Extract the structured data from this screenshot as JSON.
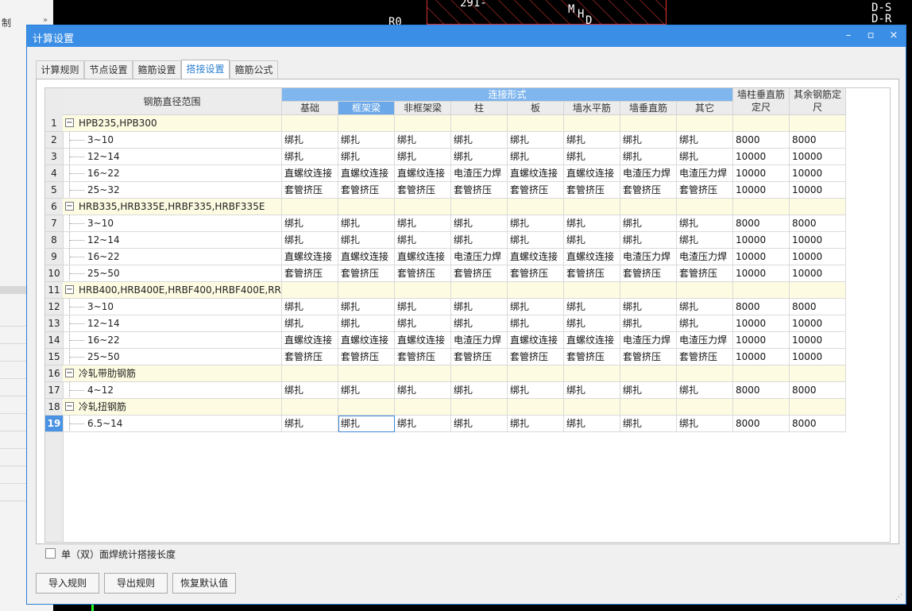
{
  "background": {
    "left_label": "制",
    "cad_texts": [
      "291-",
      "M",
      "H",
      "D",
      "D-S",
      "R0",
      "D-R"
    ]
  },
  "dialog": {
    "title": "计算设置",
    "tabs": [
      "计算规则",
      "节点设置",
      "箍筋设置",
      "搭接设置",
      "箍筋公式"
    ],
    "active_tab": "搭接设置"
  },
  "grid": {
    "name_header": "钢筋直径范围",
    "group_header": "连接形式",
    "columns": [
      "基础",
      "框架梁",
      "非框架梁",
      "柱",
      "板",
      "墙水平筋",
      "墙垂直筋",
      "其它"
    ],
    "extra_col1_line1": "墙柱垂直筋",
    "extra_col1_line2": "定尺",
    "extra_col2_line1": "其余钢筋定",
    "extra_col2_line2": "尺",
    "rows": [
      {
        "num": "1",
        "group": true,
        "name": "HPB235,HPB300"
      },
      {
        "num": "2",
        "name": "3~10",
        "vals": [
          "绑扎",
          "绑扎",
          "绑扎",
          "绑扎",
          "绑扎",
          "绑扎",
          "绑扎",
          "绑扎",
          "8000",
          "8000"
        ]
      },
      {
        "num": "3",
        "name": "12~14",
        "vals": [
          "绑扎",
          "绑扎",
          "绑扎",
          "绑扎",
          "绑扎",
          "绑扎",
          "绑扎",
          "绑扎",
          "10000",
          "10000"
        ]
      },
      {
        "num": "4",
        "name": "16~22",
        "vals": [
          "直螺纹连接",
          "直螺纹连接",
          "直螺纹连接",
          "电渣压力焊",
          "直螺纹连接",
          "直螺纹连接",
          "电渣压力焊",
          "电渣压力焊",
          "10000",
          "10000"
        ]
      },
      {
        "num": "5",
        "name": "25~32",
        "vals": [
          "套管挤压",
          "套管挤压",
          "套管挤压",
          "套管挤压",
          "套管挤压",
          "套管挤压",
          "套管挤压",
          "套管挤压",
          "10000",
          "10000"
        ]
      },
      {
        "num": "6",
        "group": true,
        "name": "HRB335,HRB335E,HRBF335,HRBF335E"
      },
      {
        "num": "7",
        "name": "3~10",
        "vals": [
          "绑扎",
          "绑扎",
          "绑扎",
          "绑扎",
          "绑扎",
          "绑扎",
          "绑扎",
          "绑扎",
          "8000",
          "8000"
        ]
      },
      {
        "num": "8",
        "name": "12~14",
        "vals": [
          "绑扎",
          "绑扎",
          "绑扎",
          "绑扎",
          "绑扎",
          "绑扎",
          "绑扎",
          "绑扎",
          "10000",
          "10000"
        ]
      },
      {
        "num": "9",
        "name": "16~22",
        "vals": [
          "直螺纹连接",
          "直螺纹连接",
          "直螺纹连接",
          "电渣压力焊",
          "直螺纹连接",
          "直螺纹连接",
          "电渣压力焊",
          "电渣压力焊",
          "10000",
          "10000"
        ]
      },
      {
        "num": "10",
        "name": "25~50",
        "vals": [
          "套管挤压",
          "套管挤压",
          "套管挤压",
          "套管挤压",
          "套管挤压",
          "套管挤压",
          "套管挤压",
          "套管挤压",
          "10000",
          "10000"
        ]
      },
      {
        "num": "11",
        "group": true,
        "name": "HRB400,HRB400E,HRBF400,HRBF400E,RR..."
      },
      {
        "num": "12",
        "name": "3~10",
        "vals": [
          "绑扎",
          "绑扎",
          "绑扎",
          "绑扎",
          "绑扎",
          "绑扎",
          "绑扎",
          "绑扎",
          "8000",
          "8000"
        ]
      },
      {
        "num": "13",
        "name": "12~14",
        "vals": [
          "绑扎",
          "绑扎",
          "绑扎",
          "绑扎",
          "绑扎",
          "绑扎",
          "绑扎",
          "绑扎",
          "10000",
          "10000"
        ]
      },
      {
        "num": "14",
        "name": "16~22",
        "vals": [
          "直螺纹连接",
          "直螺纹连接",
          "直螺纹连接",
          "电渣压力焊",
          "直螺纹连接",
          "直螺纹连接",
          "电渣压力焊",
          "电渣压力焊",
          "10000",
          "10000"
        ]
      },
      {
        "num": "15",
        "name": "25~50",
        "vals": [
          "套管挤压",
          "套管挤压",
          "套管挤压",
          "套管挤压",
          "套管挤压",
          "套管挤压",
          "套管挤压",
          "套管挤压",
          "10000",
          "10000"
        ]
      },
      {
        "num": "16",
        "group": true,
        "name": "冷轧带肋钢筋"
      },
      {
        "num": "17",
        "name": "4~12",
        "vals": [
          "绑扎",
          "绑扎",
          "绑扎",
          "绑扎",
          "绑扎",
          "绑扎",
          "绑扎",
          "绑扎",
          "8000",
          "8000"
        ]
      },
      {
        "num": "18",
        "group": true,
        "name": "冷轧扭钢筋"
      },
      {
        "num": "19",
        "name": "6.5~14",
        "active": true,
        "vals": [
          "绑扎",
          "绑扎",
          "绑扎",
          "绑扎",
          "绑扎",
          "绑扎",
          "绑扎",
          "绑扎",
          "8000",
          "8000"
        ]
      }
    ]
  },
  "checkbox_label": "单（双）面焊统计搭接长度",
  "buttons": [
    "导入规则",
    "导出规则",
    "恢复默认值"
  ],
  "window_icons": {
    "minimize": "–",
    "maximize": "▫",
    "close": "×"
  },
  "colors": {
    "titlebar": "#3a8ee6",
    "header_blue": "#7fb6ee",
    "group_row": "#fdfbe1"
  }
}
